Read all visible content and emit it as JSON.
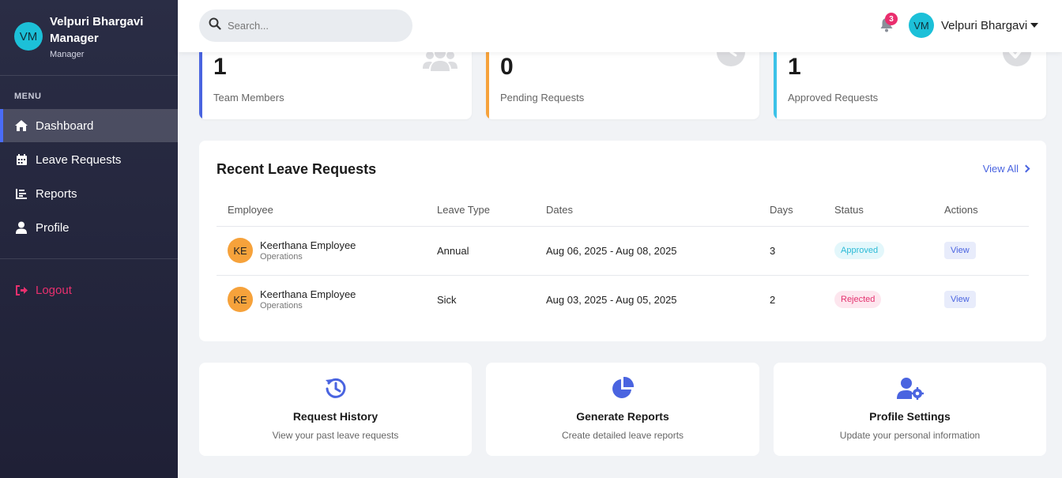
{
  "sidebar": {
    "user": {
      "initials": "VM",
      "name": "Velpuri Bhargavi Manager",
      "role": "Manager"
    },
    "menu_heading": "MENU",
    "items": [
      {
        "label": "Dashboard",
        "icon": "home-icon",
        "active": true
      },
      {
        "label": "Leave Requests",
        "icon": "calendar-icon",
        "active": false
      },
      {
        "label": "Reports",
        "icon": "chart-icon",
        "active": false
      },
      {
        "label": "Profile",
        "icon": "user-icon",
        "active": false
      }
    ],
    "logout_label": "Logout"
  },
  "topbar": {
    "search_placeholder": "Search...",
    "notification_count": "3",
    "user_initials": "VM",
    "user_name": "Velpuri Bhargavi"
  },
  "stats": [
    {
      "value": "1",
      "label": "Team Members",
      "color": "#4a64e0",
      "icon": "users-icon"
    },
    {
      "value": "0",
      "label": "Pending Requests",
      "color": "#f6a23b",
      "icon": "clock-icon"
    },
    {
      "value": "1",
      "label": "Approved Requests",
      "color": "#3bc2e8",
      "icon": "check-circle-icon"
    }
  ],
  "recent": {
    "title": "Recent Leave Requests",
    "view_all": "View All",
    "columns": [
      "Employee",
      "Leave Type",
      "Dates",
      "Days",
      "Status",
      "Actions"
    ],
    "rows": [
      {
        "initials": "KE",
        "name": "Keerthana Employee",
        "dept": "Operations",
        "type": "Annual",
        "dates": "Aug 06, 2025 - Aug 08, 2025",
        "days": "3",
        "status": "Approved",
        "action": "View"
      },
      {
        "initials": "KE",
        "name": "Keerthana Employee",
        "dept": "Operations",
        "type": "Sick",
        "dates": "Aug 03, 2025 - Aug 05, 2025",
        "days": "2",
        "status": "Rejected",
        "action": "View"
      }
    ]
  },
  "quick_actions": [
    {
      "title": "Request History",
      "subtitle": "View your past leave requests",
      "icon": "history-icon"
    },
    {
      "title": "Generate Reports",
      "subtitle": "Create detailed leave reports",
      "icon": "pie-chart-icon"
    },
    {
      "title": "Profile Settings",
      "subtitle": "Update your personal information",
      "icon": "user-cog-icon"
    }
  ],
  "colors": {
    "accent": "#4a64e0",
    "sidebar": "#24263c",
    "logout": "#e8306e"
  }
}
